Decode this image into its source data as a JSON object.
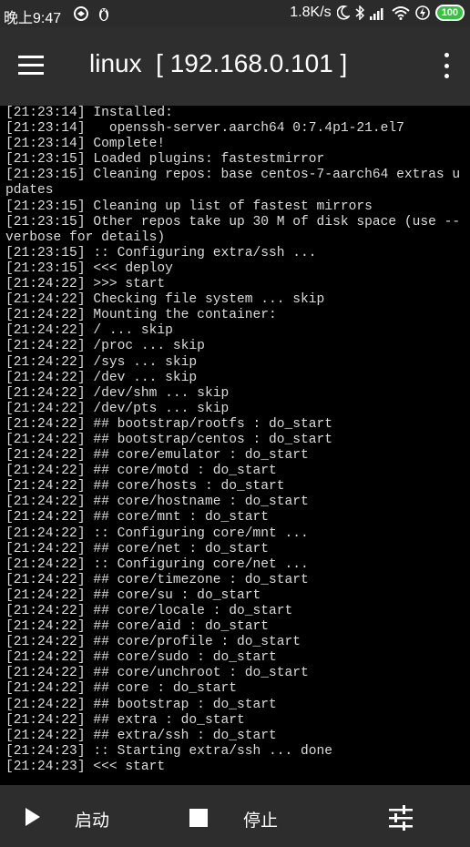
{
  "status_bar": {
    "time": "晚上9:47",
    "network_speed": "1.8K/s",
    "battery": "100"
  },
  "app_bar": {
    "title": "linux  [ 192.168.0.101 ]"
  },
  "log_lines": [
    "[21:23:14] Installed:",
    "[21:23:14]   openssh-server.aarch64 0:7.4p1-21.el7",
    "[21:23:14] Complete!",
    "[21:23:15] Loaded plugins: fastestmirror",
    "[21:23:15] Cleaning repos: base centos-7-aarch64 extras updates",
    "[21:23:15] Cleaning up list of fastest mirrors",
    "[21:23:15] Other repos take up 30 M of disk space (use --verbose for details)",
    "[21:23:15] :: Configuring extra/ssh ...",
    "[21:23:15] <<< deploy",
    "[21:24:22] >>> start",
    "[21:24:22] Checking file system ... skip",
    "[21:24:22] Mounting the container:",
    "[21:24:22] / ... skip",
    "[21:24:22] /proc ... skip",
    "[21:24:22] /sys ... skip",
    "[21:24:22] /dev ... skip",
    "[21:24:22] /dev/shm ... skip",
    "[21:24:22] /dev/pts ... skip",
    "[21:24:22] ## bootstrap/rootfs : do_start",
    "[21:24:22] ## bootstrap/centos : do_start",
    "[21:24:22] ## core/emulator : do_start",
    "[21:24:22] ## core/motd : do_start",
    "[21:24:22] ## core/hosts : do_start",
    "[21:24:22] ## core/hostname : do_start",
    "[21:24:22] ## core/mnt : do_start",
    "[21:24:22] :: Configuring core/mnt ...",
    "[21:24:22] ## core/net : do_start",
    "[21:24:22] :: Configuring core/net ...",
    "[21:24:22] ## core/timezone : do_start",
    "[21:24:22] ## core/su : do_start",
    "[21:24:22] ## core/locale : do_start",
    "[21:24:22] ## core/aid : do_start",
    "[21:24:22] ## core/profile : do_start",
    "[21:24:22] ## core/sudo : do_start",
    "[21:24:22] ## core/unchroot : do_start",
    "[21:24:22] ## core : do_start",
    "[21:24:22] ## bootstrap : do_start",
    "[21:24:22] ## extra : do_start",
    "[21:24:22] ## extra/ssh : do_start",
    "[21:24:23] :: Starting extra/ssh ... done",
    "[21:24:23] <<< start"
  ],
  "bottom_bar": {
    "start_label": "启动",
    "stop_label": "停止"
  },
  "colors": {
    "status_bar_bg": "#2b2b2b",
    "app_bar_bg": "#2e2e2e",
    "console_bg": "#000000",
    "console_text": "#dcdcdc",
    "bottom_bar_bg": "#2d2d2d",
    "battery_green": "#35c23c"
  }
}
